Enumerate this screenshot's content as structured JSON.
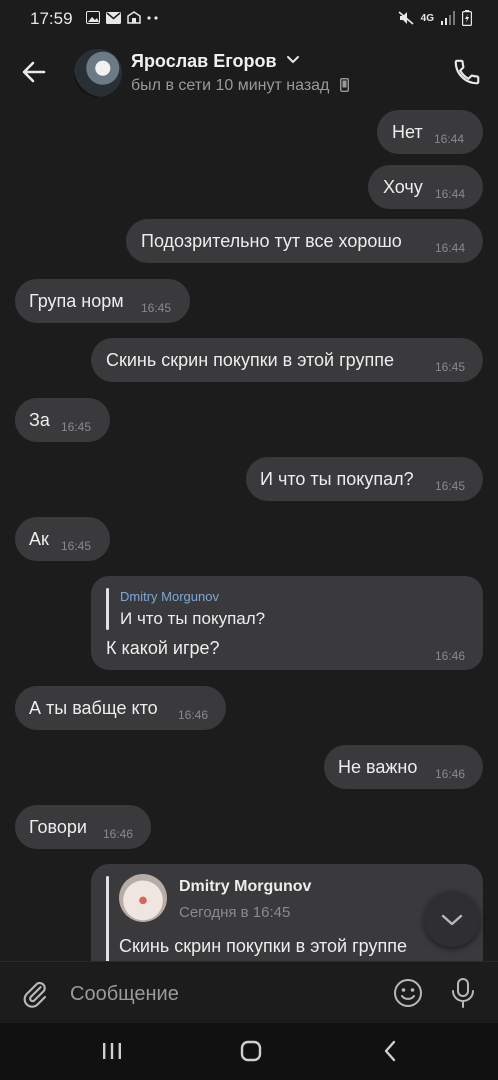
{
  "status_bar": {
    "time": "17:59",
    "network": "4G"
  },
  "header": {
    "contact_name": "Ярослав Егоров",
    "contact_status": "был в сети 10 минут назад"
  },
  "messages": [
    {
      "text": "Нет",
      "time": "16:44",
      "side": "out"
    },
    {
      "text": "Хочу",
      "time": "16:44",
      "side": "out"
    },
    {
      "text": "Подозрительно тут все хорошо",
      "time": "16:44",
      "side": "out"
    },
    {
      "text": "Група норм",
      "time": "16:45",
      "side": "in"
    },
    {
      "text": "Скинь скрин покупки в этой группе",
      "time": "16:45",
      "side": "out"
    },
    {
      "text": "За",
      "time": "16:45",
      "side": "in"
    },
    {
      "text": "И что ты покупал?",
      "time": "16:45",
      "side": "out"
    },
    {
      "text": "Ак",
      "time": "16:45",
      "side": "in"
    },
    {
      "reply_author": "Dmitry Morgunov",
      "reply_text": "И что ты покупал?",
      "text": "К какой игре?",
      "time": "16:46",
      "side": "out"
    },
    {
      "text": "А ты вабще кто",
      "time": "16:46",
      "side": "in"
    },
    {
      "text": "Не важно",
      "time": "16:46",
      "side": "out"
    },
    {
      "text": "Говори",
      "time": "16:46",
      "side": "in"
    },
    {
      "forward_author": "Dmitry Morgunov",
      "forward_date": "Сегодня в 16:45",
      "text": "Скинь скрин покупки в этой группе",
      "side": "out"
    }
  ],
  "input": {
    "placeholder": "Сообщение"
  }
}
